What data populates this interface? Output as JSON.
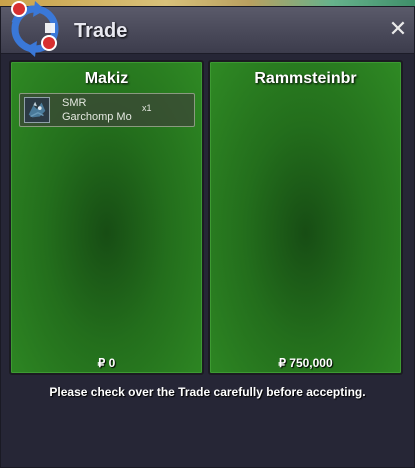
{
  "window": {
    "title": "Trade",
    "close_glyph": "✕",
    "icon": "trade-arrows-icon"
  },
  "left_panel": {
    "trader_name": "Makiz",
    "items": [
      {
        "line1": "SMR",
        "line2": "Garchomp Mo",
        "quantity": "x1",
        "icon": "garchomp-mount-icon"
      }
    ],
    "money": "₽ 0"
  },
  "right_panel": {
    "trader_name": "Rammsteinbr",
    "items": [],
    "money": "₽ 750,000"
  },
  "notice": "Please check over the Trade carefully before accepting.",
  "colors": {
    "panel_green": "#2f8a24",
    "panel_dark_green": "#174d14",
    "window_bg": "#262636",
    "titlebar": "#4a4a5a",
    "arrow_blue": "#3a78d8",
    "arrow_red": "#d83030"
  }
}
